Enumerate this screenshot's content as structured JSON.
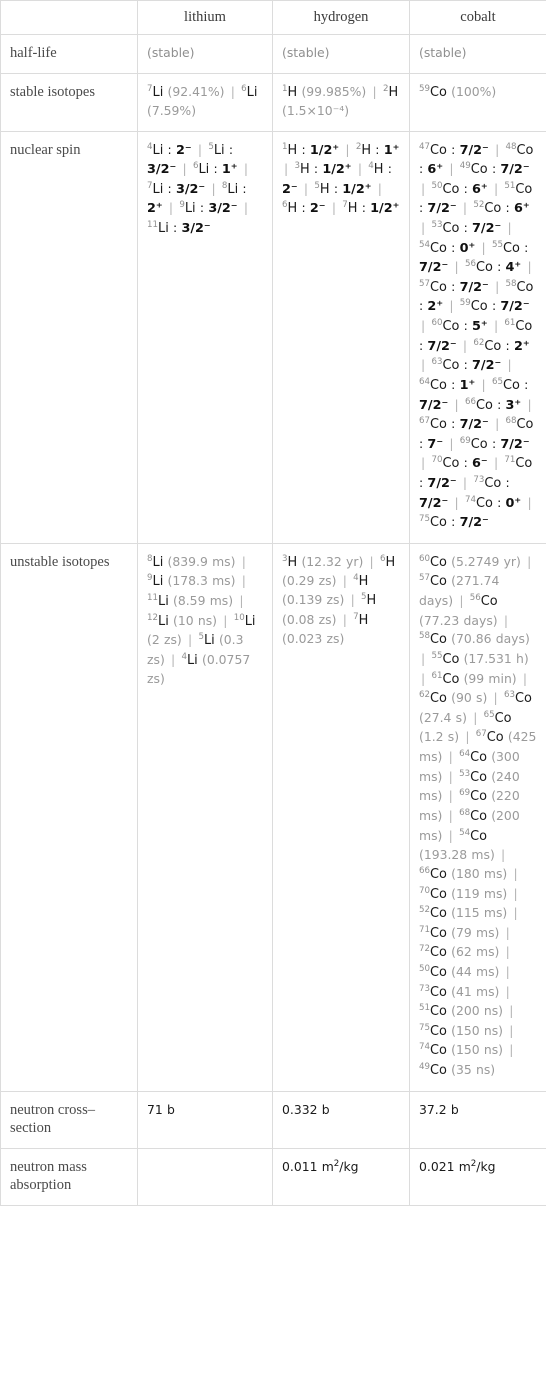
{
  "table": {
    "columns": [
      "",
      "lithium",
      "hydrogen",
      "cobalt"
    ],
    "rows": [
      {
        "label": "half-life",
        "cells": [
          {
            "text": "(stable)",
            "muted": true
          },
          {
            "text": "(stable)",
            "muted": true
          },
          {
            "text": "(stable)",
            "muted": true
          }
        ]
      },
      {
        "label": "stable isotopes",
        "cells": [
          {
            "items": [
              {
                "sup": "7",
                "sym": "Li",
                "note": "(92.41%)"
              },
              {
                "sup": "6",
                "sym": "Li",
                "note": "(7.59%)"
              }
            ]
          },
          {
            "items": [
              {
                "sup": "1",
                "sym": "H",
                "note": "(99.985%)"
              },
              {
                "sup": "2",
                "sym": "H",
                "note": "(1.5×10⁻⁴)"
              }
            ]
          },
          {
            "items": [
              {
                "sup": "59",
                "sym": "Co",
                "note": "(100%)"
              }
            ]
          }
        ]
      },
      {
        "label": "nuclear spin",
        "cells": [
          {
            "items": [
              {
                "sup": "4",
                "sym": "Li",
                "note": "2⁻"
              },
              {
                "sup": "5",
                "sym": "Li",
                "note": "3/2⁻"
              },
              {
                "sup": "6",
                "sym": "Li",
                "note": "1⁺"
              },
              {
                "sup": "7",
                "sym": "Li",
                "note": "3/2⁻"
              },
              {
                "sup": "8",
                "sym": "Li",
                "note": "2⁺"
              },
              {
                "sup": "9",
                "sym": "Li",
                "note": "3/2⁻"
              },
              {
                "sup": "11",
                "sym": "Li",
                "note": "3/2⁻"
              }
            ]
          },
          {
            "items": [
              {
                "sup": "1",
                "sym": "H",
                "note": "1/2⁺"
              },
              {
                "sup": "2",
                "sym": "H",
                "note": "1⁺"
              },
              {
                "sup": "3",
                "sym": "H",
                "note": "1/2⁺"
              },
              {
                "sup": "4",
                "sym": "H",
                "note": "2⁻"
              },
              {
                "sup": "5",
                "sym": "H",
                "note": "1/2⁺"
              },
              {
                "sup": "6",
                "sym": "H",
                "note": "2⁻"
              },
              {
                "sup": "7",
                "sym": "H",
                "note": "1/2⁺"
              }
            ]
          },
          {
            "items": [
              {
                "sup": "47",
                "sym": "Co",
                "note": "7/2⁻"
              },
              {
                "sup": "48",
                "sym": "Co",
                "note": "6⁺"
              },
              {
                "sup": "49",
                "sym": "Co",
                "note": "7/2⁻"
              },
              {
                "sup": "50",
                "sym": "Co",
                "note": "6⁺"
              },
              {
                "sup": "51",
                "sym": "Co",
                "note": "7/2⁻"
              },
              {
                "sup": "52",
                "sym": "Co",
                "note": "6⁺"
              },
              {
                "sup": "53",
                "sym": "Co",
                "note": "7/2⁻"
              },
              {
                "sup": "54",
                "sym": "Co",
                "note": "0⁺"
              },
              {
                "sup": "55",
                "sym": "Co",
                "note": "7/2⁻"
              },
              {
                "sup": "56",
                "sym": "Co",
                "note": "4⁺"
              },
              {
                "sup": "57",
                "sym": "Co",
                "note": "7/2⁻"
              },
              {
                "sup": "58",
                "sym": "Co",
                "note": "2⁺"
              },
              {
                "sup": "59",
                "sym": "Co",
                "note": "7/2⁻"
              },
              {
                "sup": "60",
                "sym": "Co",
                "note": "5⁺"
              },
              {
                "sup": "61",
                "sym": "Co",
                "note": "7/2⁻"
              },
              {
                "sup": "62",
                "sym": "Co",
                "note": "2⁺"
              },
              {
                "sup": "63",
                "sym": "Co",
                "note": "7/2⁻"
              },
              {
                "sup": "64",
                "sym": "Co",
                "note": "1⁺"
              },
              {
                "sup": "65",
                "sym": "Co",
                "note": "7/2⁻"
              },
              {
                "sup": "66",
                "sym": "Co",
                "note": "3⁺"
              },
              {
                "sup": "67",
                "sym": "Co",
                "note": "7/2⁻"
              },
              {
                "sup": "68",
                "sym": "Co",
                "note": "7⁻"
              },
              {
                "sup": "69",
                "sym": "Co",
                "note": "7/2⁻"
              },
              {
                "sup": "70",
                "sym": "Co",
                "note": "6⁻"
              },
              {
                "sup": "71",
                "sym": "Co",
                "note": "7/2⁻"
              },
              {
                "sup": "73",
                "sym": "Co",
                "note": "7/2⁻"
              },
              {
                "sup": "74",
                "sym": "Co",
                "note": "0⁺"
              },
              {
                "sup": "75",
                "sym": "Co",
                "note": "7/2⁻"
              }
            ]
          }
        ]
      },
      {
        "label": "unstable isotopes",
        "cells": [
          {
            "items": [
              {
                "sup": "8",
                "sym": "Li",
                "note": "(839.9 ms)"
              },
              {
                "sup": "9",
                "sym": "Li",
                "note": "(178.3 ms)"
              },
              {
                "sup": "11",
                "sym": "Li",
                "note": "(8.59 ms)"
              },
              {
                "sup": "12",
                "sym": "Li",
                "note": "(10 ns)"
              },
              {
                "sup": "10",
                "sym": "Li",
                "note": "(2 zs)"
              },
              {
                "sup": "5",
                "sym": "Li",
                "note": "(0.3 zs)"
              },
              {
                "sup": "4",
                "sym": "Li",
                "note": "(0.0757 zs)"
              }
            ]
          },
          {
            "items": [
              {
                "sup": "3",
                "sym": "H",
                "note": "(12.32 yr)"
              },
              {
                "sup": "6",
                "sym": "H",
                "note": "(0.29 zs)"
              },
              {
                "sup": "4",
                "sym": "H",
                "note": "(0.139 zs)"
              },
              {
                "sup": "5",
                "sym": "H",
                "note": "(0.08 zs)"
              },
              {
                "sup": "7",
                "sym": "H",
                "note": "(0.023 zs)"
              }
            ]
          },
          {
            "items": [
              {
                "sup": "60",
                "sym": "Co",
                "note": "(5.2749 yr)"
              },
              {
                "sup": "57",
                "sym": "Co",
                "note": "(271.74 days)"
              },
              {
                "sup": "56",
                "sym": "Co",
                "note": "(77.23 days)"
              },
              {
                "sup": "58",
                "sym": "Co",
                "note": "(70.86 days)"
              },
              {
                "sup": "55",
                "sym": "Co",
                "note": "(17.531 h)"
              },
              {
                "sup": "61",
                "sym": "Co",
                "note": "(99 min)"
              },
              {
                "sup": "62",
                "sym": "Co",
                "note": "(90 s)"
              },
              {
                "sup": "63",
                "sym": "Co",
                "note": "(27.4 s)"
              },
              {
                "sup": "65",
                "sym": "Co",
                "note": "(1.2 s)"
              },
              {
                "sup": "67",
                "sym": "Co",
                "note": "(425 ms)"
              },
              {
                "sup": "64",
                "sym": "Co",
                "note": "(300 ms)"
              },
              {
                "sup": "53",
                "sym": "Co",
                "note": "(240 ms)"
              },
              {
                "sup": "69",
                "sym": "Co",
                "note": "(220 ms)"
              },
              {
                "sup": "68",
                "sym": "Co",
                "note": "(200 ms)"
              },
              {
                "sup": "54",
                "sym": "Co",
                "note": "(193.28 ms)"
              },
              {
                "sup": "66",
                "sym": "Co",
                "note": "(180 ms)"
              },
              {
                "sup": "70",
                "sym": "Co",
                "note": "(119 ms)"
              },
              {
                "sup": "52",
                "sym": "Co",
                "note": "(115 ms)"
              },
              {
                "sup": "71",
                "sym": "Co",
                "note": "(79 ms)"
              },
              {
                "sup": "72",
                "sym": "Co",
                "note": "(62 ms)"
              },
              {
                "sup": "50",
                "sym": "Co",
                "note": "(44 ms)"
              },
              {
                "sup": "73",
                "sym": "Co",
                "note": "(41 ms)"
              },
              {
                "sup": "51",
                "sym": "Co",
                "note": "(200 ns)"
              },
              {
                "sup": "75",
                "sym": "Co",
                "note": "(150 ns)"
              },
              {
                "sup": "74",
                "sym": "Co",
                "note": "(150 ns)"
              },
              {
                "sup": "49",
                "sym": "Co",
                "note": "(35 ns)"
              }
            ]
          }
        ]
      },
      {
        "label": "neutron cross–section",
        "cells": [
          {
            "text": "71 b"
          },
          {
            "text": "0.332 b"
          },
          {
            "text": "37.2 b"
          }
        ]
      },
      {
        "label": "neutron mass absorption",
        "cells": [
          {
            "text": ""
          },
          {
            "text": "0.011 m²/kg"
          },
          {
            "text": "0.021 m²/kg"
          }
        ]
      }
    ]
  },
  "colors": {
    "border": "#dcdcdc",
    "text": "#1a1a1a",
    "muted": "#9a9a9a",
    "label": "#4a4a4a"
  }
}
